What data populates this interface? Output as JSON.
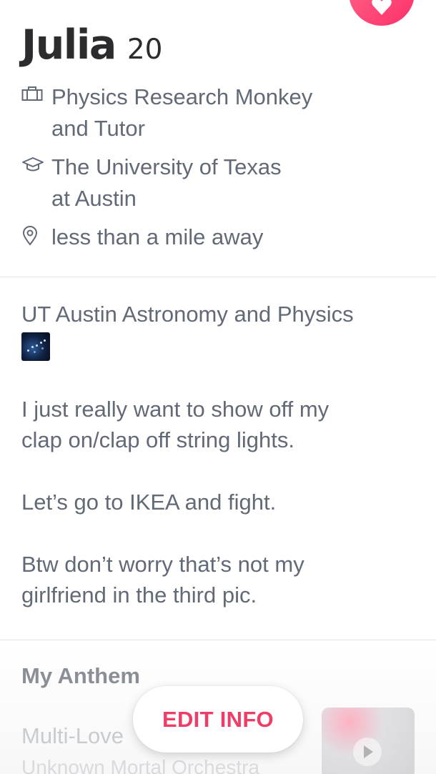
{
  "profile": {
    "name": "Julia",
    "age": "20",
    "job": [
      "Physics Research Monkey",
      "and Tutor"
    ],
    "school": [
      "The University of Texas",
      "at Austin"
    ],
    "distance": "less than a mile away"
  },
  "bio": {
    "headline": "UT Austin Astronomy and Physics",
    "paragraphs": [
      [
        "I just really want to show off my",
        "clap on/clap off string lights."
      ],
      [
        "Let’s go to IKEA and fight."
      ],
      [
        "Btw don’t worry that’s not my",
        "girlfriend in the third pic."
      ]
    ]
  },
  "anthem": {
    "section_title": "My Anthem",
    "song_title": "Multi-Love",
    "artist": "Unknown Mortal Orchestra"
  },
  "actions": {
    "edit_info_label": "EDIT INFO"
  },
  "icons": {
    "job": "briefcase-icon",
    "school": "graduation-cap-icon",
    "distance": "location-pin-icon",
    "badge": "heart-icon",
    "emoji": "milky-way-emoji",
    "play": "play-icon"
  },
  "colors": {
    "accent": "#fd2f6a",
    "edit_label": "#ee3e67",
    "name": "#2c2c2e",
    "text": "#616a76"
  }
}
